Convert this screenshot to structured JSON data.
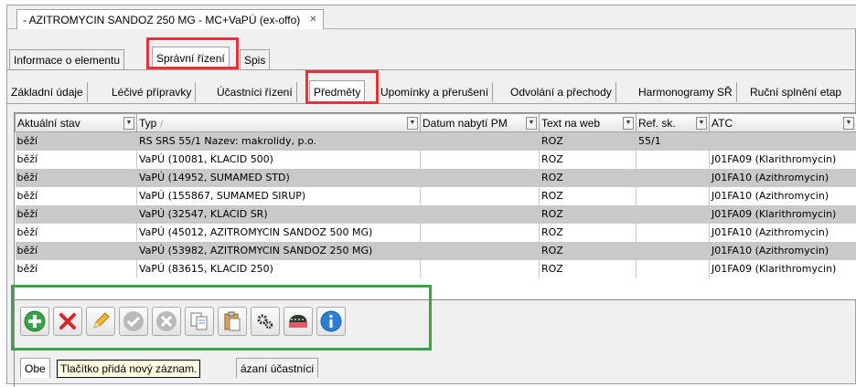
{
  "document_tab": {
    "title": "- AZITROMYCIN SANDOZ 250 MG - MC+VaPÚ (ex-offo)",
    "close_glyph": "✕"
  },
  "primary_tabs": [
    {
      "label": "Informace o elementu"
    },
    {
      "label": "Správní řízení"
    },
    {
      "label": "Spis"
    }
  ],
  "secondary_tabs": [
    {
      "label": "Základní údaje"
    },
    {
      "label": "Léčivé přípravky"
    },
    {
      "label": "Účastníci řízení"
    },
    {
      "label": "Předměty"
    },
    {
      "label": "Upomínky a přerušení"
    },
    {
      "label": "Odvolání a přechody"
    },
    {
      "label": "Harmonogramy SŘ"
    },
    {
      "label": "Ruční splnění etap"
    }
  ],
  "grid": {
    "columns": [
      {
        "label": "Aktuální stav"
      },
      {
        "label": "Typ",
        "sort": "/"
      },
      {
        "label": "Datum nabytí PM"
      },
      {
        "label": "Text na web"
      },
      {
        "label": "Ref. sk."
      },
      {
        "label": "ATC"
      }
    ],
    "rows": [
      {
        "stav": "běží",
        "typ": "RS SRS 55/1 Nazev: makrolidy, p.o.",
        "datum": "",
        "web": "ROZ",
        "ref": "55/1",
        "atc": ""
      },
      {
        "stav": "běží",
        "typ": "VaPÚ (10081, KLACID 500)",
        "datum": "",
        "web": "ROZ",
        "ref": "",
        "atc": "J01FA09 (Klarithromycin)"
      },
      {
        "stav": "běží",
        "typ": "VaPÚ (14952, SUMAMED STD)",
        "datum": "",
        "web": "ROZ",
        "ref": "",
        "atc": "J01FA10 (Azithromycin)"
      },
      {
        "stav": "běží",
        "typ": "VaPÚ (155867, SUMAMED SIRUP)",
        "datum": "",
        "web": "ROZ",
        "ref": "",
        "atc": "J01FA10 (Azithromycin)"
      },
      {
        "stav": "běží",
        "typ": "VaPÚ (32547, KLACID SR)",
        "datum": "",
        "web": "ROZ",
        "ref": "",
        "atc": "J01FA09 (Klarithromycin)"
      },
      {
        "stav": "běží",
        "typ": "VaPÚ (45012, AZITROMYCIN SANDOZ 500 MG)",
        "datum": "",
        "web": "ROZ",
        "ref": "",
        "atc": "J01FA10 (Azithromycin)"
      },
      {
        "stav": "běží",
        "typ": "VaPÚ (53982, AZITROMYCIN SANDOZ 250 MG)",
        "datum": "",
        "web": "ROZ",
        "ref": "",
        "atc": "J01FA10 (Azithromycin)"
      },
      {
        "stav": "běží",
        "typ": "VaPÚ (83615, KLACID 250)",
        "datum": "",
        "web": "ROZ",
        "ref": "",
        "atc": "J01FA09 (Klarithromycin)"
      }
    ]
  },
  "toolbar": {
    "buttons": [
      {
        "icon": "add-icon"
      },
      {
        "icon": "delete-icon"
      },
      {
        "icon": "edit-icon"
      },
      {
        "icon": "confirm-icon"
      },
      {
        "icon": "cancel-icon"
      },
      {
        "icon": "copy-icon"
      },
      {
        "icon": "paste-icon"
      },
      {
        "icon": "settings-icon"
      },
      {
        "icon": "visibility-icon"
      },
      {
        "icon": "info-icon"
      }
    ]
  },
  "bottom_tabs": [
    {
      "label": "Obe"
    },
    {
      "label": "ázaní účastníci"
    }
  ],
  "tooltip": {
    "text": "Tlačítko přidá nový záznam."
  },
  "colors": {
    "highlight_red": "#e8313b",
    "highlight_green": "#3aa34a",
    "selected_row": "#c9c9c9",
    "tooltip_bg": "#ffffe1"
  }
}
